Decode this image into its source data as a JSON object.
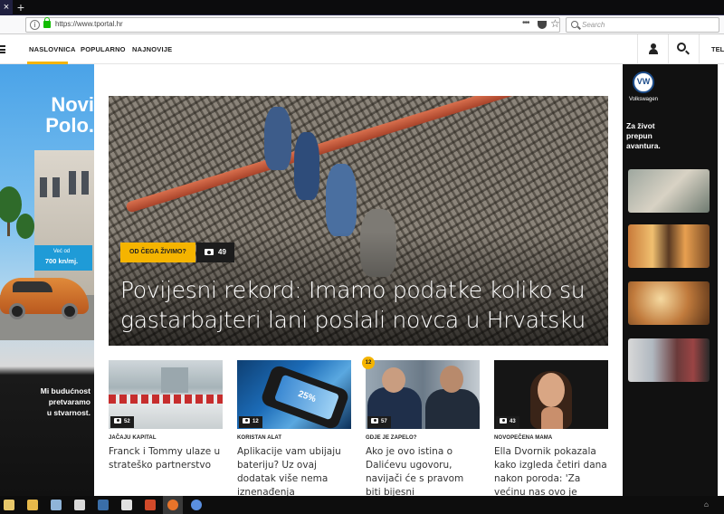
{
  "browser": {
    "tab_close": "×",
    "tab_new": "+",
    "url": "https://www.tportal.hr",
    "url_more": "•••",
    "star": "☆",
    "search_placeholder": "Search"
  },
  "site": {
    "nav": [
      "NASLOVNICA",
      "POPULARNO",
      "NAJNOVIJE"
    ],
    "tel_label": "TEL.",
    "accent": "#f5b400"
  },
  "ad_left": {
    "title_line1": "Novi",
    "title_line2": "Polo.",
    "price_small": "Već od",
    "price": "700 kn/mj.",
    "slogan_line1": "Mi budućnost",
    "slogan_line2": "pretvaramo",
    "slogan_line3": "u stvarnost."
  },
  "hero": {
    "category": "OD ČEGA ŽIVIMO?",
    "photo_count": "49",
    "title": "Povijesni rekord: Imamo podatke koliko su gastarbajteri lani poslali novca u Hrvatsku"
  },
  "cards": [
    {
      "count": "52",
      "category": "JAČAJU KAPITAL",
      "title": "Franck i Tommy ulaze u strateško partnerstvo"
    },
    {
      "count": "12",
      "category": "KORISTAN ALAT",
      "title": "Aplikacije vam ubijaju bateriju? Uz ovaj dodatak više nema iznenađenja"
    },
    {
      "count": "57",
      "category": "GDJE JE ZAPELO?",
      "badge": "12",
      "title": "Ako je ovo istina o Dalićevu ugovoru, navijači će s pravom biti bijesni"
    },
    {
      "count": "43",
      "category": "NOVOPEČENA MAMA",
      "title": "Ella Dvornik pokazala kako izgleda četiri dana nakon poroda: 'Za većinu nas ovo je realnost'"
    }
  ],
  "ad_right": {
    "brand": "Volkswagen",
    "line1": "Za život",
    "line2": "prepun",
    "line3": "avantura."
  },
  "card_phone_text": "25%"
}
